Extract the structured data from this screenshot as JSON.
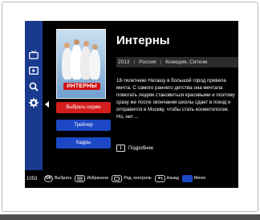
{
  "sidebar": {
    "items": [
      {
        "icon": "tv-icon"
      },
      {
        "icon": "play-icon"
      },
      {
        "icon": "search-icon"
      },
      {
        "icon": "gear-icon"
      }
    ],
    "channel_number": "1053"
  },
  "movie": {
    "title": "Интерны",
    "year": "2013",
    "country": "Россия",
    "genres": "Комедия, Ситком",
    "poster_title": "ИНТЕРНЫ",
    "description": "18-тилетнюю Наташу в большой город привела мечта. С самого раннего детства она мечтала помогать людям становиться красивыми и поэтому сразу же после окончания школы сдает в поезд и отправится в Москву, чтобы стать косметологом. Но, нет ...",
    "more_label": "Подробнее"
  },
  "actions": {
    "select_episode": "Выбрать серию",
    "trailer": "Трейлер",
    "frames": "Кадры"
  },
  "footer": {
    "ok_icon_label": "OK",
    "select": "Выбрать",
    "favorites": "Избранное",
    "parental": "Род. контроль",
    "back": "Назад",
    "menu": "Меню"
  },
  "colors": {
    "sidebar": "#193a8f",
    "primary_button": "#d41d1d",
    "secondary_button": "#1c48c6"
  }
}
